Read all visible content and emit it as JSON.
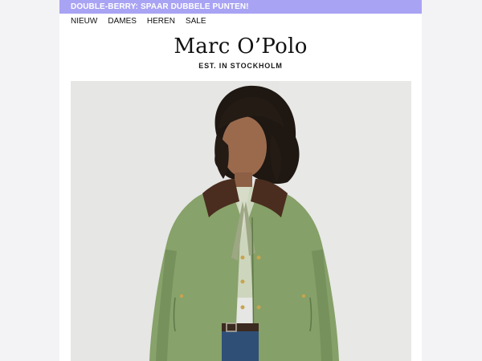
{
  "promo": {
    "text": "DOUBLE-BERRY: SPAAR DUBBELE PUNTEN!"
  },
  "nav": {
    "items": [
      "NIEUW",
      "DAMES",
      "HEREN",
      "SALE"
    ]
  },
  "brand": {
    "logo": "Marc O’Polo",
    "tagline": "EST. IN STOCKHOLM"
  },
  "hero": {
    "image": "model-in-green-jacket-photo"
  },
  "colors": {
    "promo_bar": "#a9a3f4",
    "jacket": "#87a26a",
    "collar": "#4a2d1f"
  }
}
